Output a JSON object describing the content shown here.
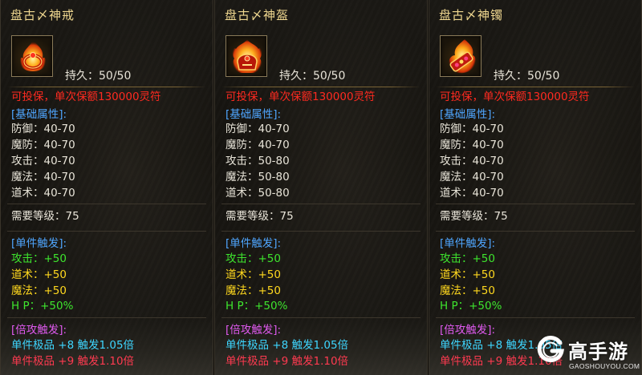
{
  "panels": [
    {
      "title": "盘古〆神戒",
      "icon": "fire-ring-icon",
      "durability": "持久：50/50",
      "insure": "可投保，单次保额130000灵符",
      "basic_header": "[基础属性]:",
      "basic": [
        "防御：40-70",
        "魔防：40-70",
        "攻击：40-70",
        "魔法：40-70",
        "道术：40-70"
      ],
      "level": "需要等级：75",
      "single_header": "[单件触发]:",
      "single": [
        "攻击：+50",
        "道术：+50",
        "魔法：+50",
        "H P：+50%"
      ],
      "multi_header": "[倍攻触发]:",
      "multi": [
        "单件极品 +8 触发1.05倍",
        "单件极品 +9 触发1.10倍"
      ]
    },
    {
      "title": "盘古〆神盔",
      "icon": "fire-helmet-icon",
      "durability": "持久：50/50",
      "insure": "可投保，单次保额130000灵符",
      "basic_header": "[基础属性]:",
      "basic": [
        "防御：40-70",
        "魔防：40-70",
        "攻击：50-80",
        "魔法：50-80",
        "道术：50-80"
      ],
      "level": "需要等级：75",
      "single_header": "[单件触发]:",
      "single": [
        "攻击：+50",
        "道术：+50",
        "魔法：+50",
        "H P：+50%"
      ],
      "multi_header": "[倍攻触发]:",
      "multi": [
        "单件极品 +8 触发1.05倍",
        "单件极品 +9 触发1.10倍"
      ]
    },
    {
      "title": "盘古〆神镯",
      "icon": "fire-bracelet-icon",
      "durability": "持久：50/50",
      "insure": "可投保，单次保额130000灵符",
      "basic_header": "[基础属性]:",
      "basic": [
        "防御：40-70",
        "魔防：40-70",
        "攻击：40-70",
        "魔法：40-70",
        "道术：40-70"
      ],
      "level": "需要等级：75",
      "single_header": "[单件触发]:",
      "single": [
        "攻击：+50",
        "道术：+50",
        "魔法：+50",
        "H P：+50%"
      ],
      "multi_header": "[倍攻触发]:",
      "multi": [
        "单件极品 +8 触发1.05倍",
        "单件极品 +9 触发1.10倍"
      ]
    }
  ],
  "watermark": {
    "brand": "高手游",
    "url": "GAOSHOUYOU.COM",
    "icon": "g-logo-icon"
  },
  "colors": {
    "title": "#f0d890",
    "insure": "#ff2a20",
    "header": "#4fa6ff",
    "attr_green": "#3ee52e",
    "attr_yellow": "#ffd81e",
    "multi_header": "#e05af0",
    "multi_plus8": "#3ed6ff",
    "multi_plus9": "#ff3a50"
  }
}
